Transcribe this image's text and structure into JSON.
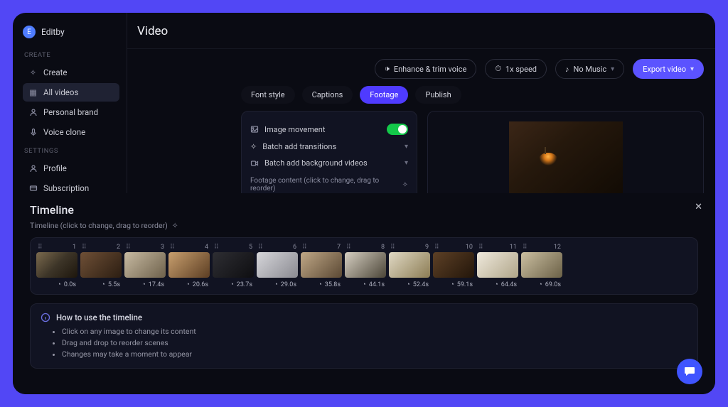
{
  "brand": {
    "avatar_letter": "E",
    "name": "Editby"
  },
  "sidebar": {
    "create_label": "CREATE",
    "settings_label": "SETTINGS",
    "items_create": [
      {
        "label": "Create"
      },
      {
        "label": "All videos"
      },
      {
        "label": "Personal brand"
      },
      {
        "label": "Voice clone"
      }
    ],
    "items_settings": [
      {
        "label": "Profile"
      },
      {
        "label": "Subscription"
      }
    ]
  },
  "page": {
    "title": "Video"
  },
  "topbar": {
    "enhance": "Enhance & trim voice",
    "speed": "1x speed",
    "music": "No Music",
    "export": "Export video"
  },
  "tabs": {
    "font": "Font style",
    "captions": "Captions",
    "footage": "Footage",
    "publish": "Publish"
  },
  "footage": {
    "image_movement": "Image movement",
    "batch_transitions": "Batch add transitions",
    "batch_bg": "Batch add background videos",
    "hint": "Footage content  (click to change, drag to reorder)"
  },
  "timeline": {
    "title": "Timeline",
    "hint": "Timeline  (click to change, drag to reorder)",
    "clips": [
      {
        "idx": "1",
        "dur": "0.0s"
      },
      {
        "idx": "2",
        "dur": "5.5s"
      },
      {
        "idx": "3",
        "dur": "17.4s"
      },
      {
        "idx": "4",
        "dur": "20.6s"
      },
      {
        "idx": "5",
        "dur": "23.7s"
      },
      {
        "idx": "6",
        "dur": "29.0s"
      },
      {
        "idx": "7",
        "dur": "35.8s"
      },
      {
        "idx": "8",
        "dur": "44.1s"
      },
      {
        "idx": "9",
        "dur": "52.4s"
      },
      {
        "idx": "10",
        "dur": "59.1s"
      },
      {
        "idx": "11",
        "dur": "64.4s"
      },
      {
        "idx": "12",
        "dur": "69.0s"
      }
    ]
  },
  "help": {
    "title": "How to use the timeline",
    "items": [
      "Click on any image to change its content",
      "Drag and drop to reorder scenes",
      "Changes may take a moment to appear"
    ]
  }
}
